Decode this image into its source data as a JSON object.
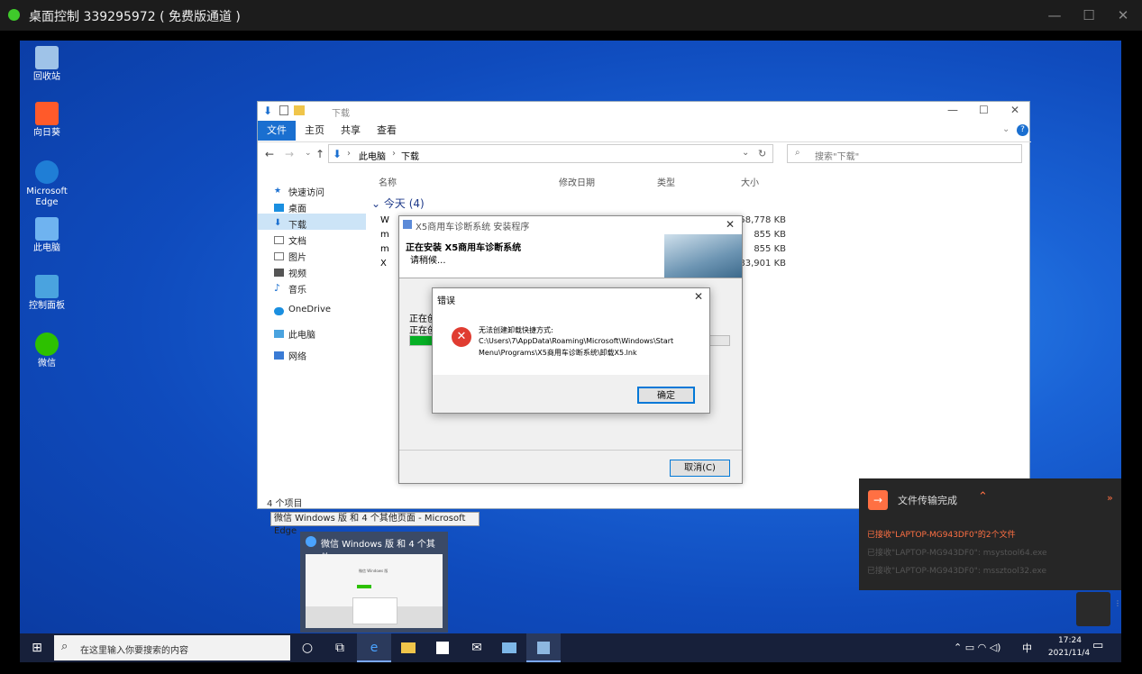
{
  "remote": {
    "title": "桌面控制 339295972 ( 免费版通道 )",
    "controls": [
      "—",
      "☐",
      "✕"
    ],
    "pull_tab": "⌄"
  },
  "desktop_icons": [
    {
      "label": "回收站",
      "icon": "recycle-bin-icon",
      "color": "#9fc3e8"
    },
    {
      "label": "向日葵",
      "icon": "sunlogin-icon",
      "color": "#ff5a2a"
    },
    {
      "label": "Microsoft Edge",
      "icon": "edge-icon",
      "color": "#1f7ed6"
    },
    {
      "label": "此电脑",
      "icon": "this-pc-icon",
      "color": "#6fb3f0"
    },
    {
      "label": "控制面板",
      "icon": "control-panel-icon",
      "color": "#4aa3df"
    },
    {
      "label": "微信",
      "icon": "wechat-icon",
      "color": "#2dc100"
    }
  ],
  "explorer": {
    "title": "下载",
    "tabs": [
      "文件",
      "主页",
      "共享",
      "查看"
    ],
    "path": [
      "此电脑",
      "下载"
    ],
    "search_placeholder": "搜索\"下载\"",
    "columns": [
      "名称",
      "修改日期",
      "类型",
      "大小"
    ],
    "group": "今天 (4)",
    "nav_items": [
      "快速访问",
      "桌面",
      "下载",
      "文档",
      "图片",
      "视频",
      "音乐",
      "OneDrive",
      "此电脑",
      "网络"
    ],
    "files": [
      {
        "name": "W",
        "size": "158,778 KB"
      },
      {
        "name": "m",
        "size": "855 KB"
      },
      {
        "name": "m",
        "size": "855 KB"
      },
      {
        "name": "X",
        "size": "83,901 KB"
      }
    ],
    "status": "4 个项目"
  },
  "installer": {
    "title": "X5商用车诊断系统 安装程序",
    "heading": "正在安装 X5商用车诊断系统",
    "sub": "请稍候...",
    "line1": "正在创",
    "line2": "正在创",
    "progress": 0.13,
    "cancel": "取消(C)"
  },
  "error": {
    "title": "错误",
    "message": "无法创建卸载快捷方式:",
    "path1": "C:\\Users\\7\\AppData\\Roaming\\Microsoft\\Windows\\Start",
    "path2": "Menu\\Programs\\X5商用车诊断系统\\卸载X5.lnk",
    "ok": "确定"
  },
  "tooltip": "微信 Windows 版 和 4 个其他页面 - Microsoft Edge",
  "thumb": {
    "title": "微信 Windows 版 和 4 个其他...",
    "inner": "微信 Windows 版"
  },
  "notification": {
    "title": "文件传输完成",
    "main": "已接收\"LAPTOP-MG943DF0\"的2个文件",
    "f1": "已接收\"LAPTOP-MG943DF0\": msystool64.exe",
    "f2": "已接收\"LAPTOP-MG943DF0\": mssztool32.exe"
  },
  "taskbar": {
    "search_placeholder": "在这里输入你要搜索的内容",
    "time": "17:24",
    "date": "2021/11/4",
    "ime": "中"
  }
}
